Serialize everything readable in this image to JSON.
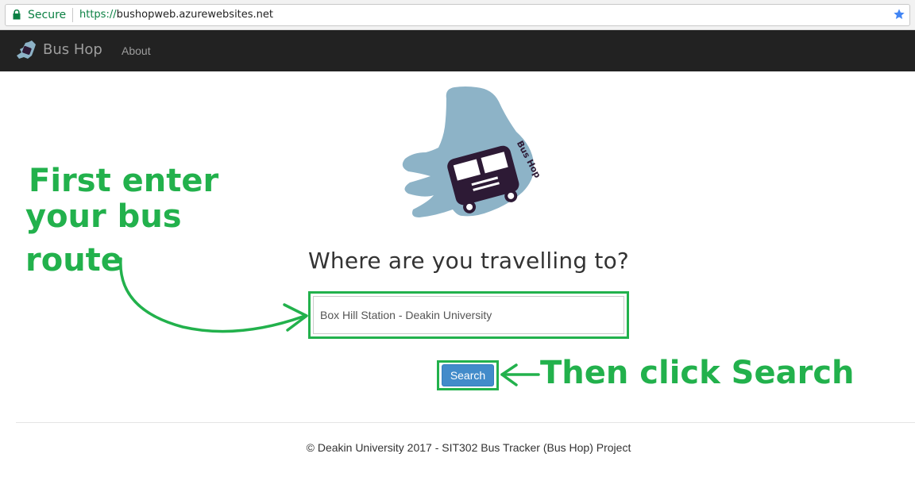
{
  "browser": {
    "secure_label": "Secure",
    "url_scheme": "https://",
    "url_host": "bushopweb.azurewebsites.net"
  },
  "navbar": {
    "brand": "Bus Hop",
    "links": [
      "About"
    ]
  },
  "logo": {
    "text": "Bus Hop"
  },
  "main": {
    "heading": "Where are you travelling to?",
    "route_input_value": "Box Hill Station - Deakin University",
    "search_label": "Search"
  },
  "annotations": {
    "line1": "First enter",
    "line2": "your bus",
    "line3": "route",
    "search_hint": "Then click Search"
  },
  "footer": {
    "text": "© Deakin University 2017 - SIT302 Bus Tracker (Bus Hop) Project"
  },
  "colors": {
    "annotation_green": "#22b14c",
    "navbar_bg": "#222222",
    "button_blue": "#428bca",
    "hand_blue": "#8db3c7",
    "bus_purple": "#2d1a35"
  }
}
